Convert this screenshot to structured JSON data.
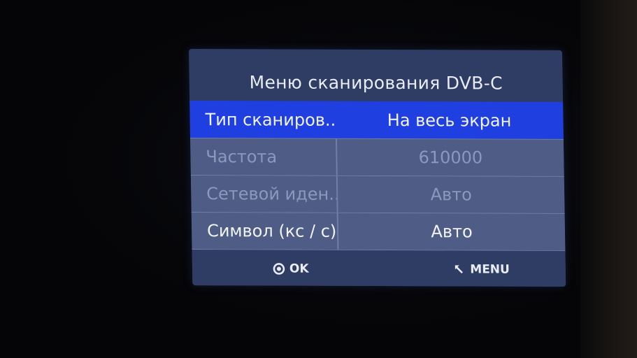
{
  "menu": {
    "title": "Меню сканирования DVB-C",
    "rows": [
      {
        "label": "Тип сканиров...",
        "value": "На весь экран",
        "state": "selected"
      },
      {
        "label": "Частота",
        "value": "610000",
        "state": "disabled"
      },
      {
        "label": "Сетевой иден...",
        "value": "Авто",
        "state": "disabled"
      },
      {
        "label": "Символ (кс / с)",
        "value": "Авто",
        "state": "normal"
      }
    ]
  },
  "footer": {
    "ok_label": "OK",
    "ok_icon": "ok-button-icon",
    "menu_label": "MENU",
    "menu_icon": "return-arrow-icon"
  },
  "colors": {
    "panel": "#2f3c63",
    "selected_row": "#1f3fe0",
    "row": "#4e5c86"
  }
}
